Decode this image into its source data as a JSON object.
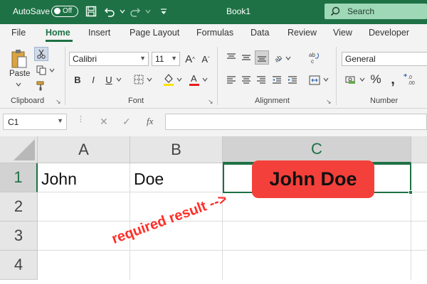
{
  "titlebar": {
    "autosave_label": "AutoSave",
    "autosave_state": "Off",
    "title": "Book1",
    "search_label": "Search"
  },
  "tabs": [
    "File",
    "Home",
    "Insert",
    "Page Layout",
    "Formulas",
    "Data",
    "Review",
    "View",
    "Developer"
  ],
  "active_tab": "Home",
  "ribbon": {
    "clipboard": {
      "paste_label": "Paste",
      "group_label": "Clipboard"
    },
    "font": {
      "font_name": "Calibri",
      "font_size": "11",
      "group_label": "Font"
    },
    "alignment": {
      "group_label": "Alignment"
    },
    "number": {
      "format": "General",
      "group_label": "Number"
    }
  },
  "formula_bar": {
    "name_box": "C1",
    "fx_label": "fx",
    "value": ""
  },
  "grid": {
    "columns": [
      "A",
      "B",
      "C"
    ],
    "rows": [
      "1",
      "2",
      "3",
      "4"
    ],
    "cells": {
      "A1": "John",
      "B1": "Doe",
      "C1": ""
    },
    "selected_cell": "C1"
  },
  "overlay": {
    "result": "John Doe",
    "annotation": "required result -->"
  },
  "colors": {
    "excel_green": "#1e7145",
    "badge_red": "#f4403a",
    "annotation_red": "#ff2e28"
  }
}
